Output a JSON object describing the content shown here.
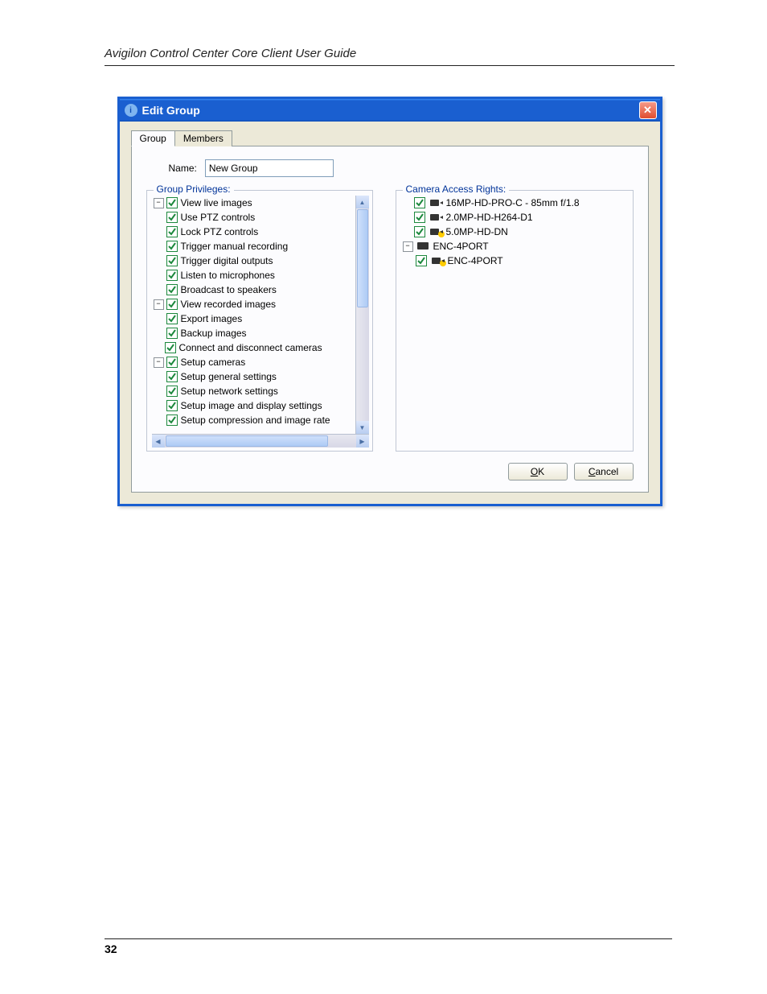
{
  "doc": {
    "header": "Avigilon Control Center Core Client User Guide",
    "page_number": "32"
  },
  "dialog": {
    "title": "Edit Group",
    "tabs": {
      "group": "Group",
      "members": "Members"
    },
    "name_label": "Name:",
    "name_value": "New Group",
    "privileges_legend": "Group Privileges:",
    "rights_legend": "Camera Access Rights:",
    "ok": "OK",
    "cancel": "Cancel"
  },
  "privileges": [
    {
      "label": "View live images",
      "expand": "-",
      "children": [
        {
          "label": "Use PTZ controls"
        },
        {
          "label": "Lock PTZ controls"
        },
        {
          "label": "Trigger manual recording"
        },
        {
          "label": "Trigger digital outputs"
        },
        {
          "label": "Listen to microphones"
        },
        {
          "label": "Broadcast to speakers"
        }
      ]
    },
    {
      "label": "View recorded images",
      "expand": "-",
      "children": [
        {
          "label": "Export images"
        },
        {
          "label": "Backup images"
        }
      ]
    },
    {
      "label": "Connect and disconnect cameras"
    },
    {
      "label": "Setup cameras",
      "expand": "-",
      "children": [
        {
          "label": "Setup general settings"
        },
        {
          "label": "Setup network settings"
        },
        {
          "label": "Setup image and display settings"
        },
        {
          "label": "Setup compression and image rate"
        }
      ]
    }
  ],
  "cameras": [
    {
      "label": "16MP-HD-PRO-C - 85mm f/1.8",
      "icon": "cam"
    },
    {
      "label": "2.0MP-HD-H264-D1",
      "icon": "cam"
    },
    {
      "label": "5.0MP-HD-DN",
      "icon": "cam",
      "warn": true
    },
    {
      "label": "ENC-4PORT",
      "icon": "enc",
      "nocheck": true,
      "expand": "-",
      "children": [
        {
          "label": "ENC-4PORT",
          "icon": "cam",
          "warn": true
        }
      ]
    }
  ]
}
